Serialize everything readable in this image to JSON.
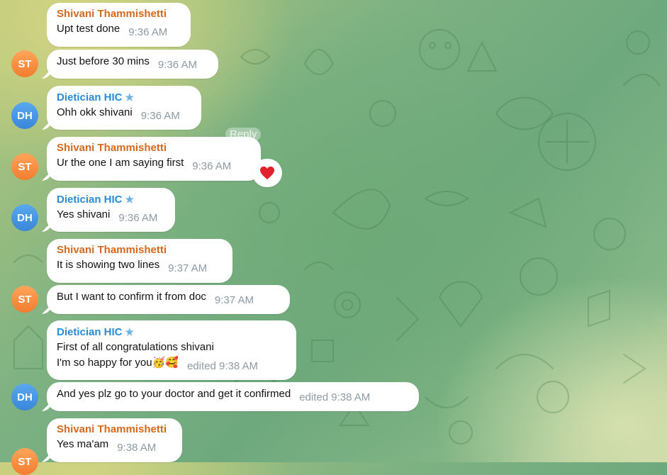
{
  "messages": [
    {
      "sender": "Shivani Thammishetti",
      "lines": [
        "Upt test done"
      ],
      "time": "9:36 AM"
    },
    {
      "lines": [
        "Just before 30 mins"
      ],
      "time": "9:36 AM",
      "avatar": "ST"
    },
    {
      "sender": "Dietician HIC",
      "lines": [
        "Ohh okk shivani"
      ],
      "time": "9:36 AM",
      "avatar": "DH"
    },
    {
      "sender": "Shivani Thammishetti",
      "lines": [
        "Ur the one I am saying first"
      ],
      "time": "9:36 AM",
      "avatar": "ST",
      "reaction": "red-heart"
    },
    {
      "sender": "Dietician HIC",
      "lines": [
        "Yes shivani"
      ],
      "time": "9:36 AM",
      "avatar": "DH"
    },
    {
      "sender": "Shivani Thammishetti",
      "lines": [
        "It is showing two lines"
      ],
      "time": "9:37 AM"
    },
    {
      "lines": [
        "But I want to confirm it from doc"
      ],
      "time": "9:37 AM",
      "avatar": "ST"
    },
    {
      "sender": "Dietician HIC",
      "lines": [
        "First of all congratulations shivani",
        "I'm so happy for you🥳🥰"
      ],
      "time": "edited 9:38 AM"
    },
    {
      "lines": [
        "And yes plz go to your doctor and get it confirmed"
      ],
      "time": "edited 9:38 AM",
      "avatar": "DH"
    },
    {
      "sender": "Shivani Thammishetti",
      "lines": [
        "Yes ma'am"
      ],
      "time": "9:38 AM",
      "avatar": "ST"
    }
  ],
  "reply_label": "Reply",
  "star_glyph": "★",
  "heart_glyph": "❤️",
  "colors": {
    "orange_sender": "#d2691e",
    "blue_sender": "#2a8bd6",
    "time": "#8d9aa4",
    "bubble": "#ffffff"
  }
}
